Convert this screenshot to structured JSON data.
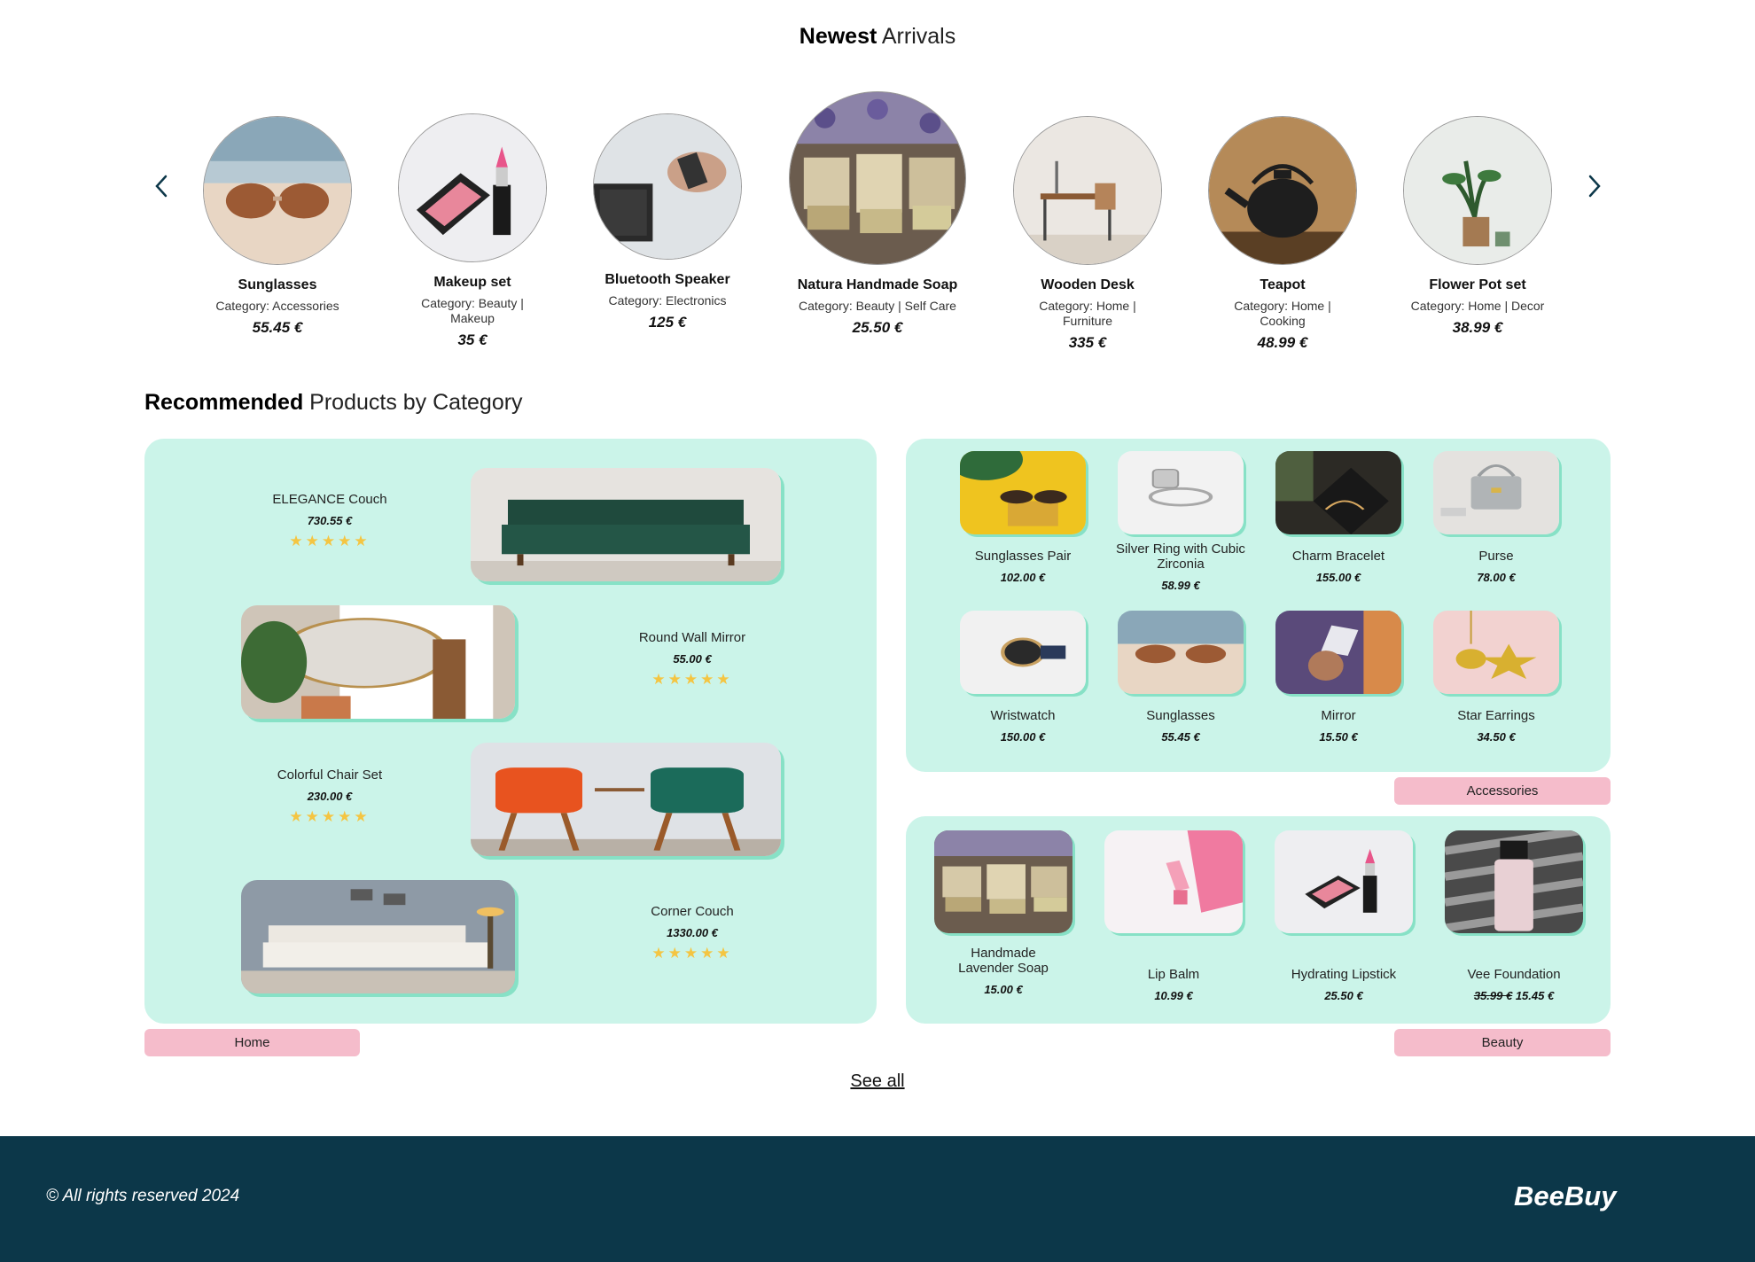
{
  "newest": {
    "title_bold": "Newest",
    "title_rest": " Arrivals",
    "items": [
      {
        "name": "Sunglasses",
        "category": "Category: Accessories",
        "price": "55.45 €"
      },
      {
        "name": "Makeup set",
        "category": "Category: Beauty | Makeup",
        "price": "35 €"
      },
      {
        "name": "Bluetooth Speaker",
        "category": "Category: Electronics",
        "price": "125 €"
      },
      {
        "name": "Natura Handmade Soap",
        "category": "Category: Beauty | Self Care",
        "price": "25.50 €"
      },
      {
        "name": "Wooden Desk",
        "category": "Category: Home | Furniture",
        "price": "335 €"
      },
      {
        "name": "Teapot",
        "category": "Category: Home | Cooking",
        "price": "48.99 €"
      },
      {
        "name": "Flower Pot set",
        "category": "Category: Home | Decor",
        "price": "38.99 €"
      }
    ]
  },
  "recommended": {
    "title_bold": "Recommended",
    "title_rest": " Products by Category",
    "home": {
      "tag": "Home",
      "items": [
        {
          "name": "ELEGANCE Couch",
          "price": "730.55 €",
          "rating": 5
        },
        {
          "name": "Round Wall Mirror",
          "price": "55.00 €",
          "rating": 5
        },
        {
          "name": "Colorful Chair Set",
          "price": "230.00 €",
          "rating": 5
        },
        {
          "name": "Corner Couch",
          "price": "1330.00 €",
          "rating": 5
        }
      ],
      "stars": "★★★★★"
    },
    "accessories": {
      "tag": "Accessories",
      "items": [
        {
          "name": "Sunglasses Pair",
          "price": "102.00 €"
        },
        {
          "name": "Silver Ring with Cubic Zirconia",
          "price": "58.99 €"
        },
        {
          "name": "Charm Bracelet",
          "price": "155.00 €"
        },
        {
          "name": "Purse",
          "price": "78.00 €"
        },
        {
          "name": "Wristwatch",
          "price": "150.00 €"
        },
        {
          "name": "Sunglasses",
          "price": "55.45 €"
        },
        {
          "name": "Mirror",
          "price": "15.50 €"
        },
        {
          "name": "Star Earrings",
          "price": "34.50 €"
        }
      ]
    },
    "beauty": {
      "tag": "Beauty",
      "items": [
        {
          "name": "Handmade Lavender Soap",
          "price": "15.00 €"
        },
        {
          "name": "Lip Balm",
          "price": "10.99 €"
        },
        {
          "name": "Hydrating Lipstick",
          "price": "25.50 €"
        },
        {
          "name": "Vee Foundation",
          "old_price": "35.99 €",
          "price": "15.45 €"
        }
      ]
    }
  },
  "see_all": "See all",
  "footer": {
    "copyright": "© All rights reserved 2024",
    "brand": "BeeBuy",
    "color": "#0c3749"
  },
  "colors": {
    "panel": "#cbf4e9",
    "tag": "#f5bccb",
    "star": "#f4c542"
  },
  "icons": {
    "prev": "chevron-left-icon",
    "next": "chevron-right-icon"
  }
}
